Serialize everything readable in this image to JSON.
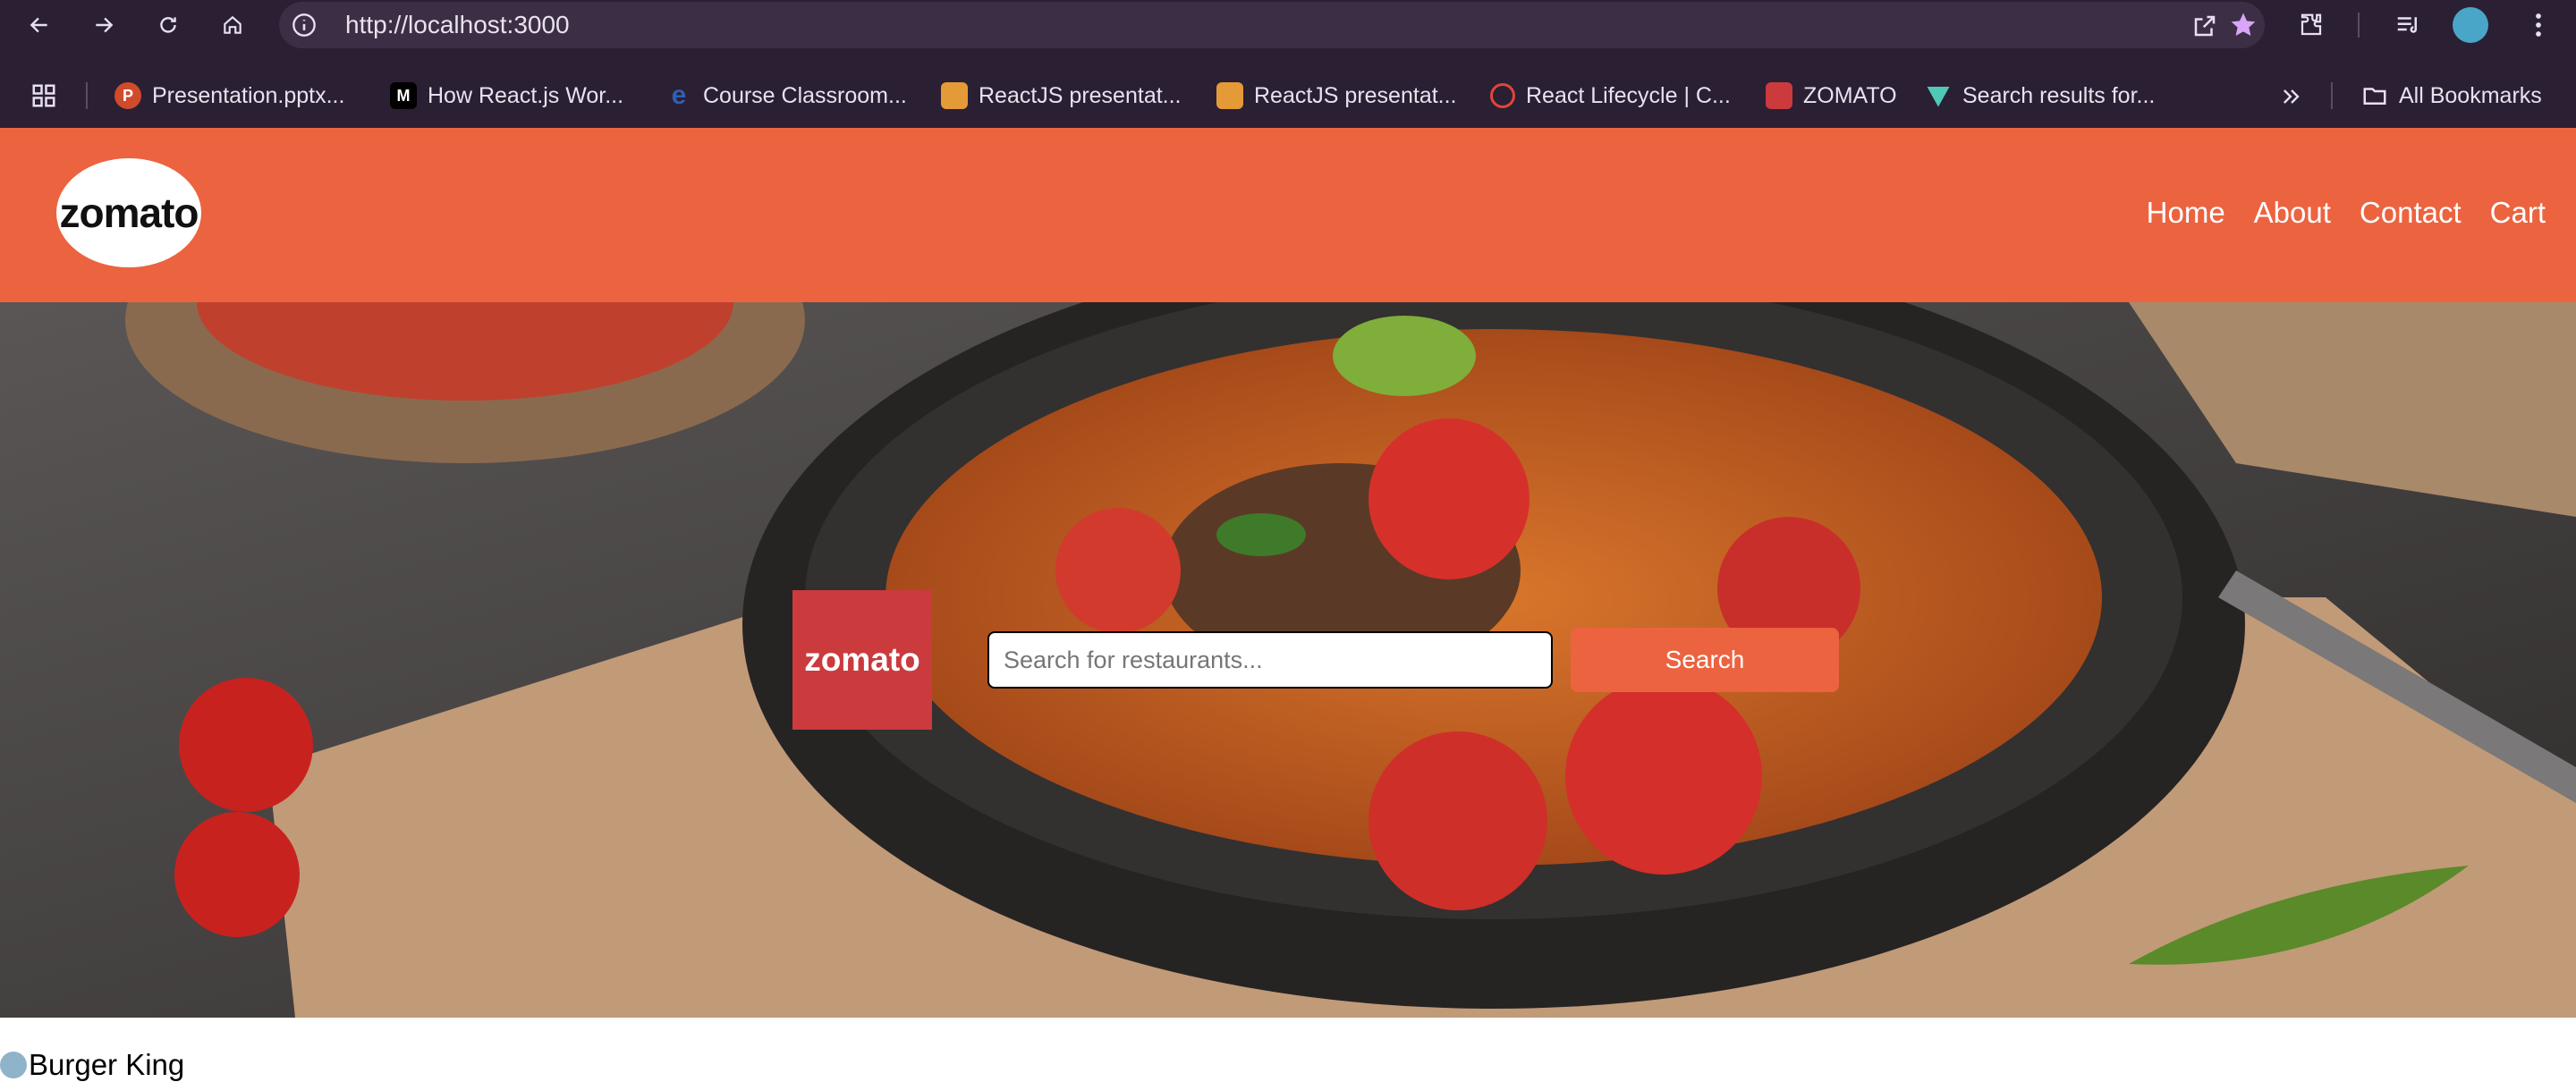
{
  "browser": {
    "url": "http://localhost:3000",
    "nav_icons": [
      "back-icon",
      "forward-icon",
      "reload-icon",
      "home-icon"
    ],
    "right_icons": [
      "open-in-new-icon",
      "bookmark-star-icon",
      "extensions-icon",
      "reading-list-icon",
      "profile-avatar",
      "more-menu-icon"
    ],
    "bookmarks": [
      {
        "label": "Presentation.pptx...",
        "icon": "powerpoint-icon",
        "color": "#d04a2c"
      },
      {
        "label": "How React.js Wor...",
        "icon": "medium-icon",
        "color": "#000000"
      },
      {
        "label": "Course Classroom...",
        "icon": "edureka-icon",
        "color": "#2f5fb3"
      },
      {
        "label": "ReactJS presentat...",
        "icon": "slides-icon",
        "color": "#e59a38"
      },
      {
        "label": "ReactJS presentat...",
        "icon": "slides-icon",
        "color": "#e59a38"
      },
      {
        "label": "React Lifecycle | C...",
        "icon": "geeks-icon",
        "color": "#e0453a"
      },
      {
        "label": "ZOMATO",
        "icon": "zomato-icon",
        "color": "#cb3a3d"
      },
      {
        "label": "Search results for...",
        "icon": "vercel-icon",
        "color": "#4fc9b5"
      }
    ],
    "all_bookmarks_label": "All Bookmarks"
  },
  "navbar": {
    "logo_text": "zomato",
    "links": [
      "Home",
      "About",
      "Contact",
      "Cart"
    ],
    "background": "#ec6340"
  },
  "hero": {
    "brand_tile_text": "zomato",
    "search_placeholder": "Search for restaurants...",
    "search_button": "Search"
  },
  "restaurants": [
    {
      "name": "Burger King"
    }
  ]
}
